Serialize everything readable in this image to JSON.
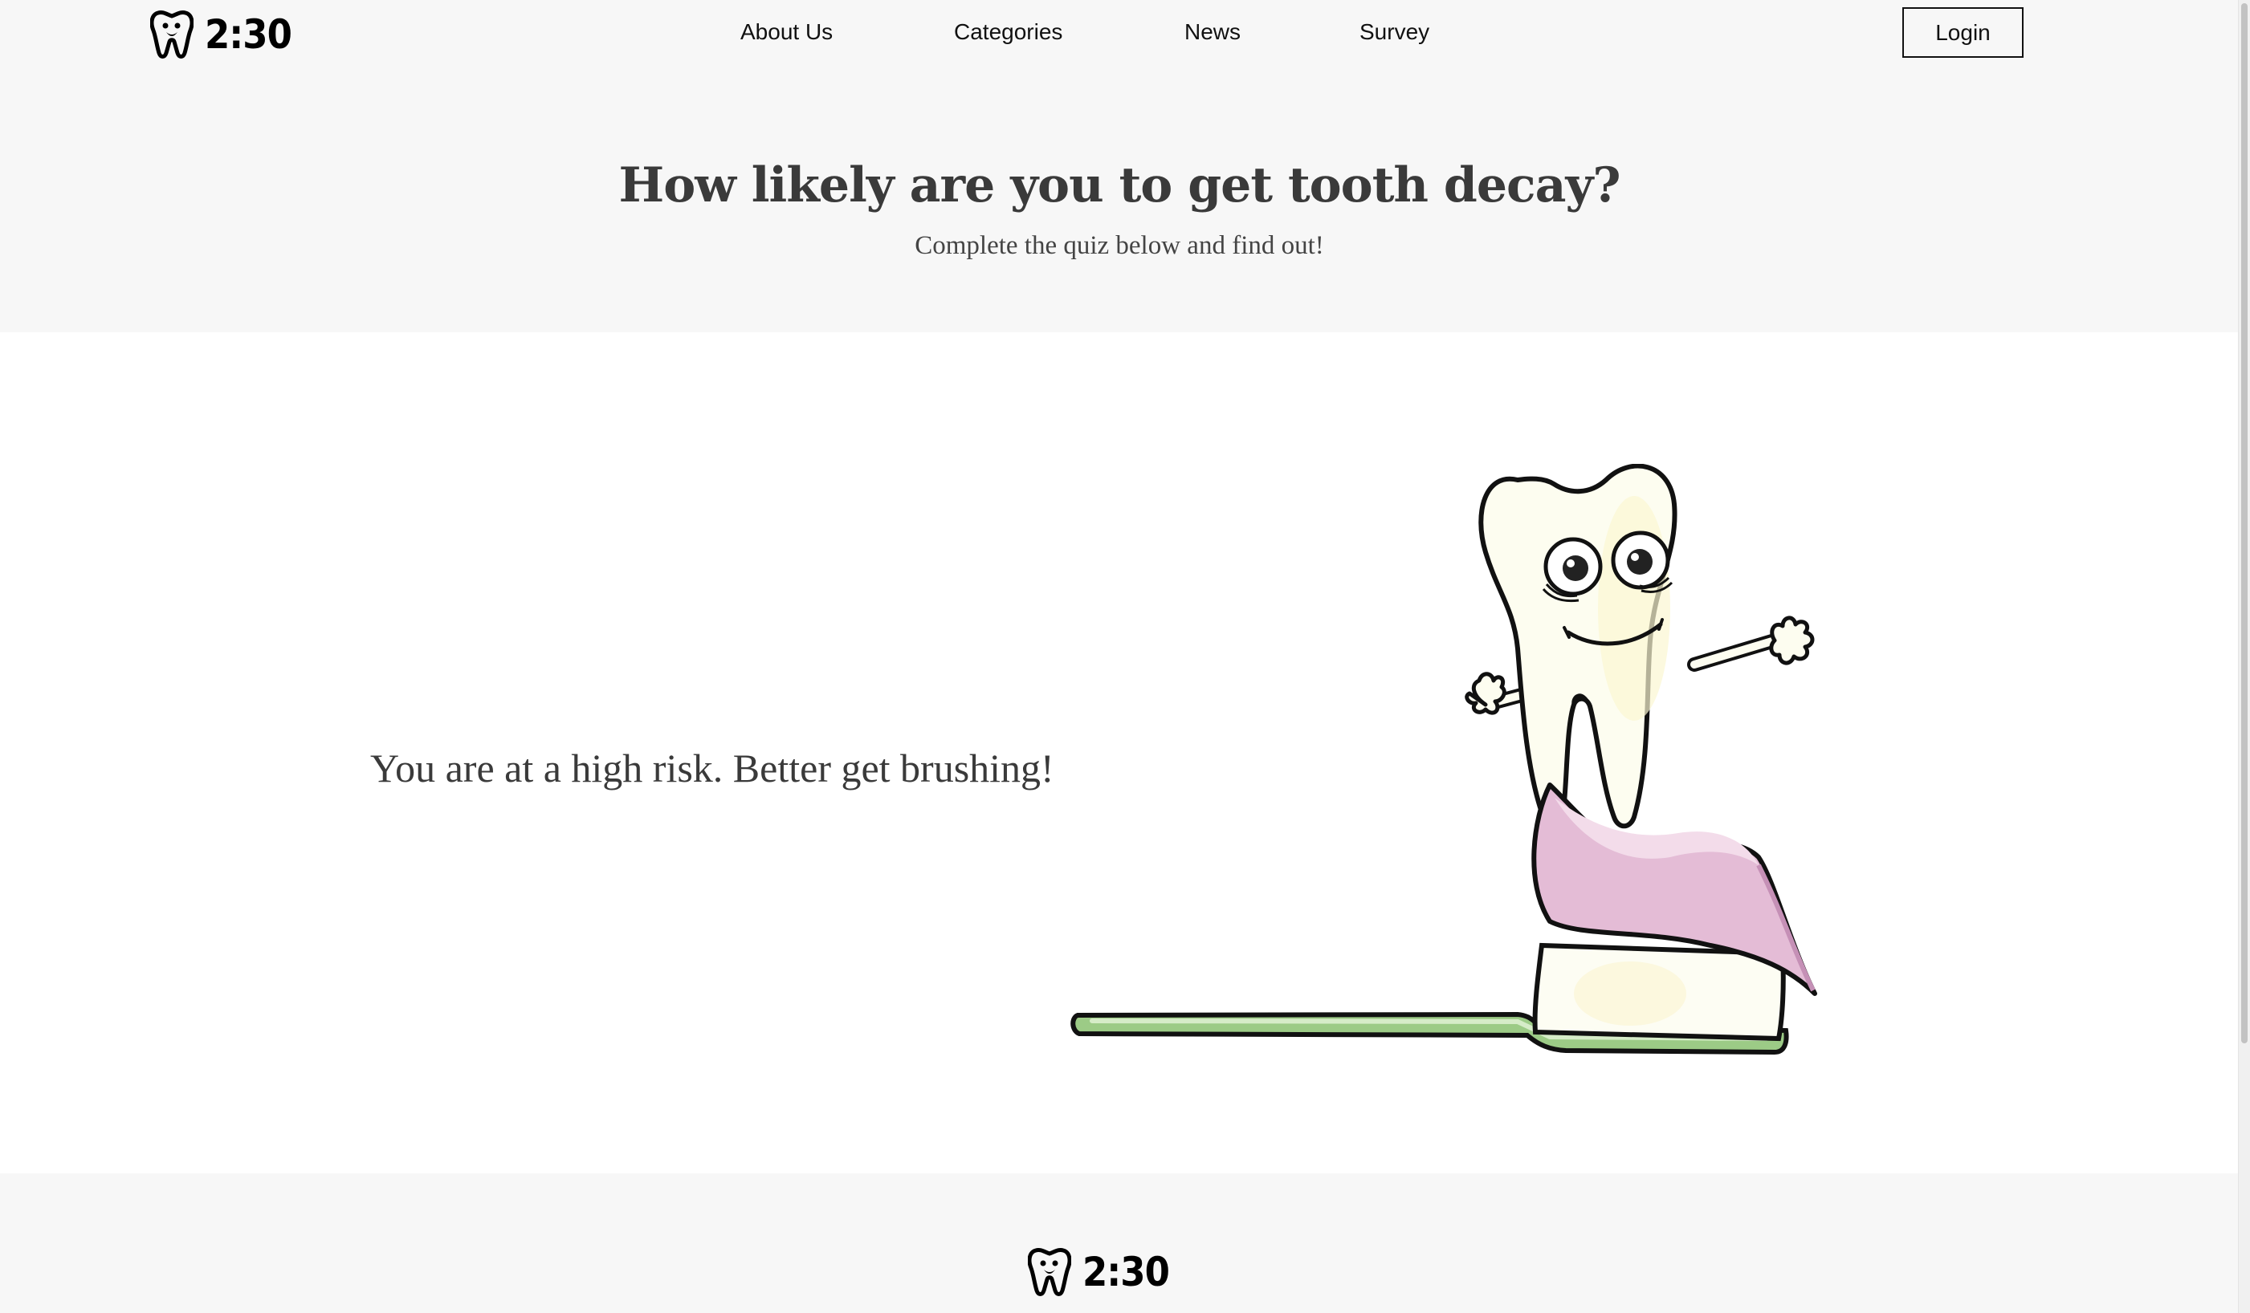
{
  "header": {
    "logo_text": "2:30",
    "logo_icon": "tooth-icon",
    "nav": [
      {
        "label": "About Us"
      },
      {
        "label": "Categories"
      },
      {
        "label": "News"
      },
      {
        "label": "Survey"
      }
    ],
    "login_label": "Login"
  },
  "hero": {
    "title": "How likely are you to get tooth decay?",
    "subtitle": "Complete the quiz below and find out!"
  },
  "result": {
    "message": "You are at a high risk. Better get brushing!",
    "illustration": "tooth-on-toothbrush-illustration"
  },
  "footer": {
    "logo_text": "2:30",
    "logo_icon": "tooth-icon"
  },
  "colors": {
    "page_bg": "#f7f7f7",
    "section_bg": "#ffffff",
    "text": "#3a3a3a",
    "toothpaste": "#e4bcd6",
    "brush_handle": "#9ccb86",
    "tooth": "#fdfdf0"
  }
}
